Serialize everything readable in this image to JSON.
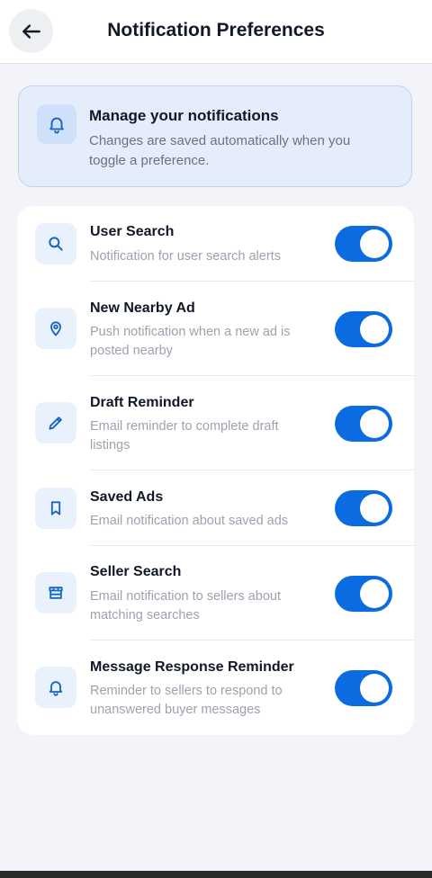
{
  "header": {
    "title": "Notification Preferences",
    "back_icon": "arrow-left-icon"
  },
  "info": {
    "title": "Manage your notifications",
    "description": "Changes are saved automatically when you toggle a preference.",
    "icon": "bell-icon"
  },
  "colors": {
    "accent": "#0b6be0",
    "icon_color": "#1565c0",
    "info_background": "#e5edfa",
    "page_background": "#f3f4f9"
  },
  "preferences": [
    {
      "title": "User Search",
      "description": "Notification for user search alerts",
      "icon": "search-icon",
      "enabled": true
    },
    {
      "title": "New Nearby Ad",
      "description": "Push notification when a new ad is posted nearby",
      "icon": "location-pin-icon",
      "enabled": true
    },
    {
      "title": "Draft Reminder",
      "description": "Email reminder to complete draft listings",
      "icon": "pencil-icon",
      "enabled": true
    },
    {
      "title": "Saved Ads",
      "description": "Email notification about saved ads",
      "icon": "bookmark-icon",
      "enabled": true
    },
    {
      "title": "Seller Search",
      "description": "Email notification to sellers about matching searches",
      "icon": "storefront-icon",
      "enabled": true
    },
    {
      "title": "Message Response Reminder",
      "description": "Reminder to sellers to respond to unanswered buyer messages",
      "icon": "bell-icon",
      "enabled": true
    }
  ]
}
